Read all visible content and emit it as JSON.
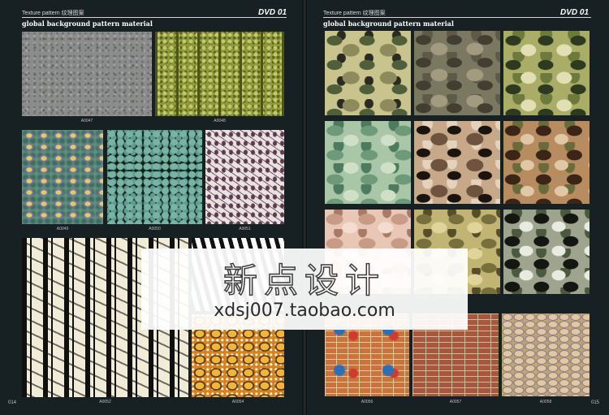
{
  "left_page": {
    "header": "Texture pattern 纹理图案",
    "dvd": "DVD 01",
    "subtitle": "global background pattern material",
    "page_number": "014",
    "captions": [
      "A0047",
      "A0048",
      "A0049",
      "A0050",
      "A0051",
      "A0052",
      "A0054"
    ]
  },
  "right_page": {
    "header": "Texture pattern 纹理图案",
    "dvd": "DVD 01",
    "subtitle": "global background pattern material",
    "page_number": "015",
    "captions": [
      "A0056",
      "A0057",
      "A0058"
    ]
  },
  "watermark": {
    "chinese": "新点设计",
    "url": "xdsj007.taobao.com"
  },
  "colors": {
    "background": "#141b1d",
    "text": "#ffffff"
  }
}
